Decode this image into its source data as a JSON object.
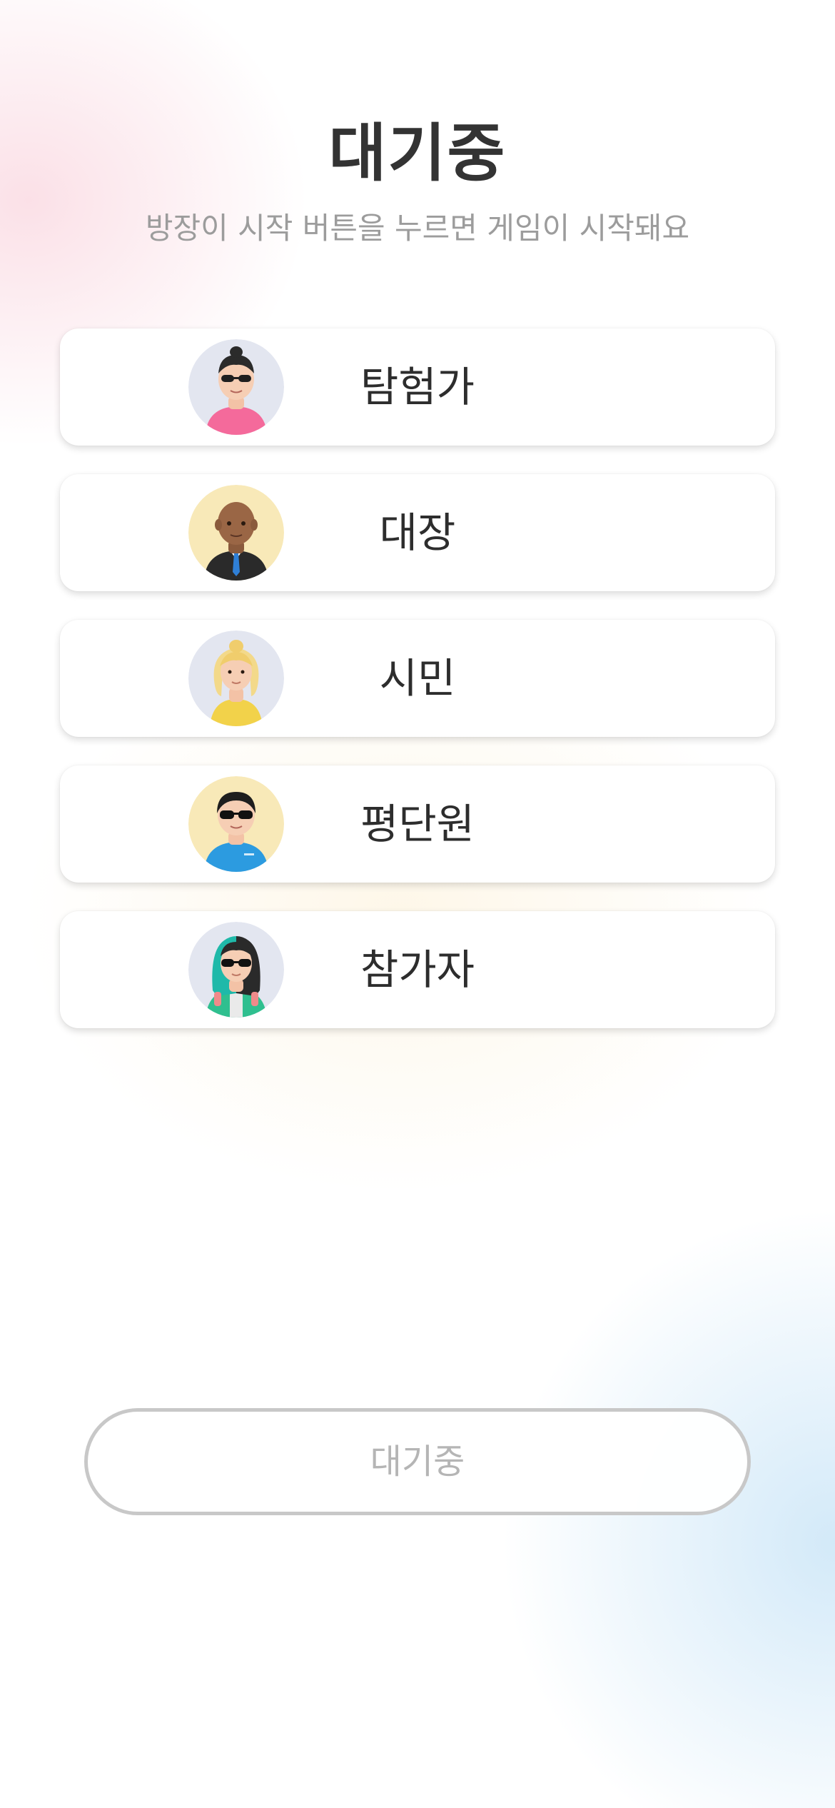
{
  "header": {
    "title": "대기중",
    "subtitle": "방장이 시작 버튼을 누르면 게임이 시작돼요"
  },
  "players": [
    {
      "name": "탐험가",
      "avatar_icon": "avatar-man-pink-shirt-sunglasses-icon",
      "avatar_bg": "#e3e6f0"
    },
    {
      "name": "대장",
      "avatar_icon": "avatar-man-black-suit-icon",
      "avatar_bg": "#f8e9b8"
    },
    {
      "name": "시민",
      "avatar_icon": "avatar-woman-blonde-yellow-top-icon",
      "avatar_bg": "#e3e6f0"
    },
    {
      "name": "평단원",
      "avatar_icon": "avatar-man-blue-shirt-sunglasses-icon",
      "avatar_bg": "#f8e9b8"
    },
    {
      "name": "참가자",
      "avatar_icon": "avatar-woman-teal-hair-sunglasses-icon",
      "avatar_bg": "#e3e6f0"
    }
  ],
  "button": {
    "label": "대기중"
  },
  "colors": {
    "title": "#333333",
    "subtitle": "#9c9c9c",
    "button_border": "#c8c8c8",
    "button_text": "#b5b5b5"
  }
}
